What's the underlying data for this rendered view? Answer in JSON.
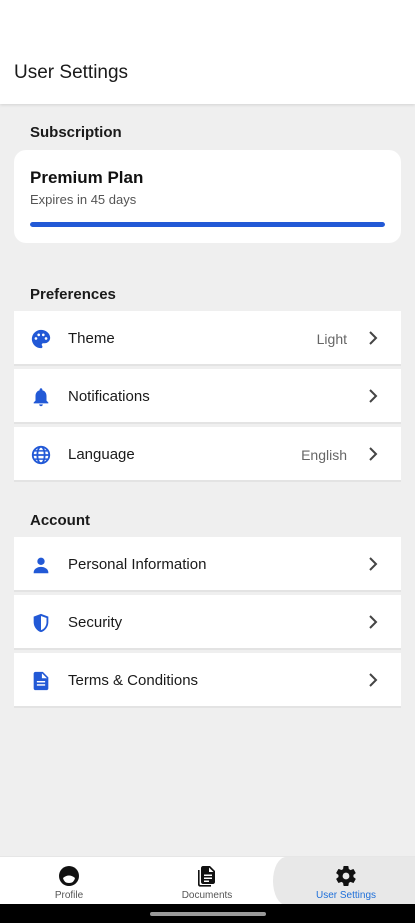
{
  "header": {
    "title": "User Settings"
  },
  "subscription": {
    "section_title": "Subscription",
    "plan_name": "Premium Plan",
    "expires": "Expires in 45 days",
    "progress_fraction": 1.0
  },
  "preferences": {
    "section_title": "Preferences",
    "items": [
      {
        "label": "Theme",
        "value": "Light",
        "icon": "palette-icon"
      },
      {
        "label": "Notifications",
        "value": "",
        "icon": "bell-icon"
      },
      {
        "label": "Language",
        "value": "English",
        "icon": "globe-icon"
      }
    ]
  },
  "account": {
    "section_title": "Account",
    "items": [
      {
        "label": "Personal Information",
        "icon": "person-icon"
      },
      {
        "label": "Security",
        "icon": "shield-icon"
      },
      {
        "label": "Terms & Conditions",
        "icon": "document-icon"
      }
    ]
  },
  "bottom_nav": {
    "items": [
      {
        "label": "Profile",
        "icon": "profile-face-icon"
      },
      {
        "label": "Documents",
        "icon": "documents-icon"
      },
      {
        "label": "User Settings",
        "icon": "gear-icon",
        "active": true
      }
    ]
  },
  "colors": {
    "accent": "#2259d6",
    "active_label": "#1e6fd9"
  }
}
